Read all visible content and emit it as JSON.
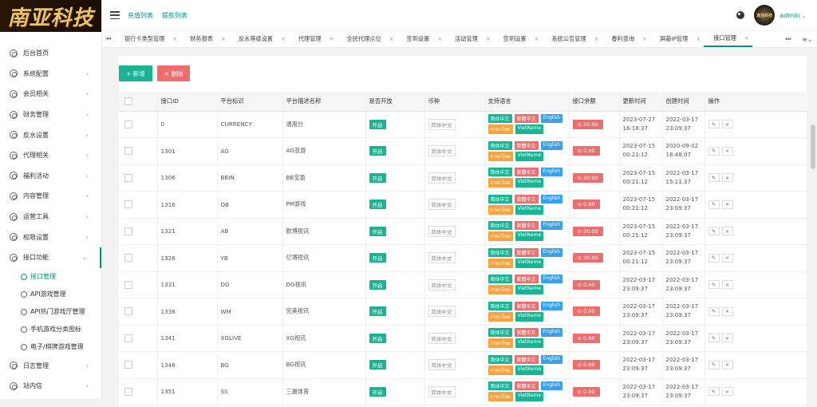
{
  "logo": {
    "text": "南亚科技"
  },
  "sidebar": {
    "items": [
      {
        "label": "后台首页",
        "arrow": ""
      },
      {
        "label": "系统配置",
        "arrow": "›"
      },
      {
        "label": "会员相关",
        "arrow": "›"
      },
      {
        "label": "财务管理",
        "arrow": "›"
      },
      {
        "label": "反水设置",
        "arrow": "›"
      },
      {
        "label": "代理相关",
        "arrow": "›"
      },
      {
        "label": "福利活动",
        "arrow": "›"
      },
      {
        "label": "内容管理",
        "arrow": "›"
      },
      {
        "label": "运营工具",
        "arrow": "›"
      },
      {
        "label": "权限设置",
        "arrow": "›"
      },
      {
        "label": "接口功能",
        "arrow": "⌄"
      }
    ],
    "subitems": [
      {
        "label": "接口管理"
      },
      {
        "label": "API游戏管理"
      },
      {
        "label": "API热门游戏厅管理"
      },
      {
        "label": "手机游戏分类图标"
      },
      {
        "label": "电子/棋牌游戏管理"
      }
    ],
    "bottom_items": [
      {
        "label": "日志管理",
        "arrow": "›"
      },
      {
        "label": "站内信",
        "arrow": "›"
      }
    ]
  },
  "topbar": {
    "link1": "充值列表",
    "link2": "提款列表",
    "avatar_text": "南亚科技",
    "user": "admin",
    "caret": "⌄"
  },
  "tabsbar": {
    "left_nav": "⏮",
    "tabs": [
      {
        "label": "银行卡类型管理",
        "close": "×"
      },
      {
        "label": "财务报表",
        "close": "×"
      },
      {
        "label": "反水等级设置",
        "close": "×"
      },
      {
        "label": "代理管理",
        "close": "×"
      },
      {
        "label": "全民代理点位",
        "close": "×"
      },
      {
        "label": "签到设置",
        "close": "×"
      },
      {
        "label": "活动管理",
        "close": "×"
      },
      {
        "label": "签到设置",
        "close": "×"
      },
      {
        "label": "系统公告管理",
        "close": "×"
      },
      {
        "label": "春利查询",
        "close": "×"
      },
      {
        "label": "屏蔽IP管理",
        "close": "×"
      },
      {
        "label": "接口管理",
        "close": "×"
      }
    ],
    "right_nav": "⏭",
    "menu": "≡⌄"
  },
  "toolbar": {
    "add_label": "+ 新增",
    "delete_label": "× 删除"
  },
  "table": {
    "headers": [
      "",
      "接口ID",
      "平台标识",
      "平台描述名称",
      "是否开放",
      "币种",
      "支持语言",
      "接口余额",
      "更新时间",
      "创建时间",
      "操作"
    ],
    "open_label": "开启",
    "currency_label": "简体中文",
    "langs": [
      "简体中文",
      "繁體中文",
      "English",
      "ภาษาไทย",
      "VietName"
    ],
    "edit_icon": "✎",
    "delete_icon": "×",
    "rows": [
      {
        "id": "0",
        "code": "CURRENCY",
        "name": "通用分",
        "balance": "⊙ 20.00",
        "updated_date": "2023-07-27",
        "updated_time": "16:18:37",
        "created_date": "2022-03-17",
        "created_time": "23:09:37"
      },
      {
        "id": "1301",
        "code": "AG",
        "name": "AG亚游",
        "balance": "⊙ 0.00",
        "updated_date": "2023-07-15",
        "updated_time": "00:21:12",
        "created_date": "2020-09-02",
        "created_time": "18:48:07"
      },
      {
        "id": "1306",
        "code": "BBIN",
        "name": "BB宝盈",
        "balance": "⊙ 20.00",
        "updated_date": "2023-07-15",
        "updated_time": "00:21:12",
        "created_date": "2022-03-17",
        "created_time": "15:11:37"
      },
      {
        "id": "1316",
        "code": "OB",
        "name": "PM游戏",
        "balance": "⊙ 0.00",
        "updated_date": "2023-07-15",
        "updated_time": "00:21:12",
        "created_date": "2022-03-17",
        "created_time": "23:09:37"
      },
      {
        "id": "1321",
        "code": "AB",
        "name": "欧博视讯",
        "balance": "⊙ 20.00",
        "updated_date": "2023-07-15",
        "updated_time": "00:21:12",
        "created_date": "2022-03-17",
        "created_time": "23:09:37"
      },
      {
        "id": "1326",
        "code": "YB",
        "name": "亿博视讯",
        "balance": "⊙ 20.00",
        "updated_date": "2023-07-15",
        "updated_time": "00:21:12",
        "created_date": "2022-03-17",
        "created_time": "23:09:37"
      },
      {
        "id": "1331",
        "code": "DG",
        "name": "DG视讯",
        "balance": "⊙ 0.00",
        "updated_date": "2022-03-17",
        "updated_time": "23:09:37",
        "created_date": "2022-03-17",
        "created_time": "23:09:37"
      },
      {
        "id": "1336",
        "code": "WM",
        "name": "完美视讯",
        "balance": "⊙ 0.00",
        "updated_date": "2022-03-17",
        "updated_time": "23:09:37",
        "created_date": "2022-03-17",
        "created_time": "23:09:37"
      },
      {
        "id": "1341",
        "code": "XGLIVE",
        "name": "XG视讯",
        "balance": "⊙ 0.00",
        "updated_date": "2022-03-17",
        "updated_time": "23:09:37",
        "created_date": "2022-03-17",
        "created_time": "23:09:37"
      },
      {
        "id": "1346",
        "code": "BG",
        "name": "BG视讯",
        "balance": "⊙ 0.00",
        "updated_date": "2022-03-17",
        "updated_time": "23:09:37",
        "created_date": "2022-03-17",
        "created_time": "23:09:37"
      },
      {
        "id": "1351",
        "code": "SS",
        "name": "三晟体育",
        "balance": "⊙ 0.00",
        "updated_date": "2022-03-17",
        "updated_time": "23:09:37",
        "created_date": "2022-03-17",
        "created_time": "23:09:37"
      }
    ]
  }
}
